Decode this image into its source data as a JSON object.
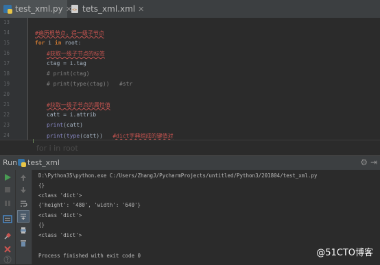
{
  "tabs": [
    {
      "label": "test_xml.py",
      "active": true
    },
    {
      "label": "tets_xml.xml",
      "active": false
    }
  ],
  "editor": {
    "line_numbers": [
      "13",
      "14",
      "15",
      "16",
      "17",
      "18",
      "19",
      "20",
      "21",
      "22",
      "23",
      "24"
    ],
    "lines": {
      "l14_cmt": "#遍历根节点，得一级子节点",
      "l15_kw": "for",
      "l15_mid": " i ",
      "l15_kw2": "in",
      "l15_end": " root:",
      "l16_cmt": "#获取一级子节点的标签",
      "l17": "ctag = i.tag",
      "l18": "# print(ctag)",
      "l19": "# print(type(ctag))   #str",
      "l21_cmt": "#获取一级子节点的属性值",
      "l22": "catt = i.attrib",
      "l23_fn": "print",
      "l23_arg": "(catt)",
      "l24_fn": "print",
      "l24_a": "(",
      "l24_fn2": "type",
      "l24_b": "(catt))   ",
      "l24_cmt": "#dict字典组成的键值对"
    },
    "ghost_text": "for i in root"
  },
  "run": {
    "label": "Run",
    "config": "test_xml"
  },
  "console_lines": [
    "D:\\Python35\\python.exe C:/Users/ZhangJ/PycharmProjects/untitled/Python3/201804/test_xml.py",
    "{}",
    "<class 'dict'>",
    "{'height': '480', 'width': '640'}",
    "<class 'dict'>",
    "{}",
    "<class 'dict'>",
    "",
    "Process finished with exit code 0"
  ],
  "watermark": "@51CTO博客",
  "colors": {
    "run_green": "#499c54",
    "stop_red": "#c75450",
    "accent_blue": "#4a88c7"
  }
}
